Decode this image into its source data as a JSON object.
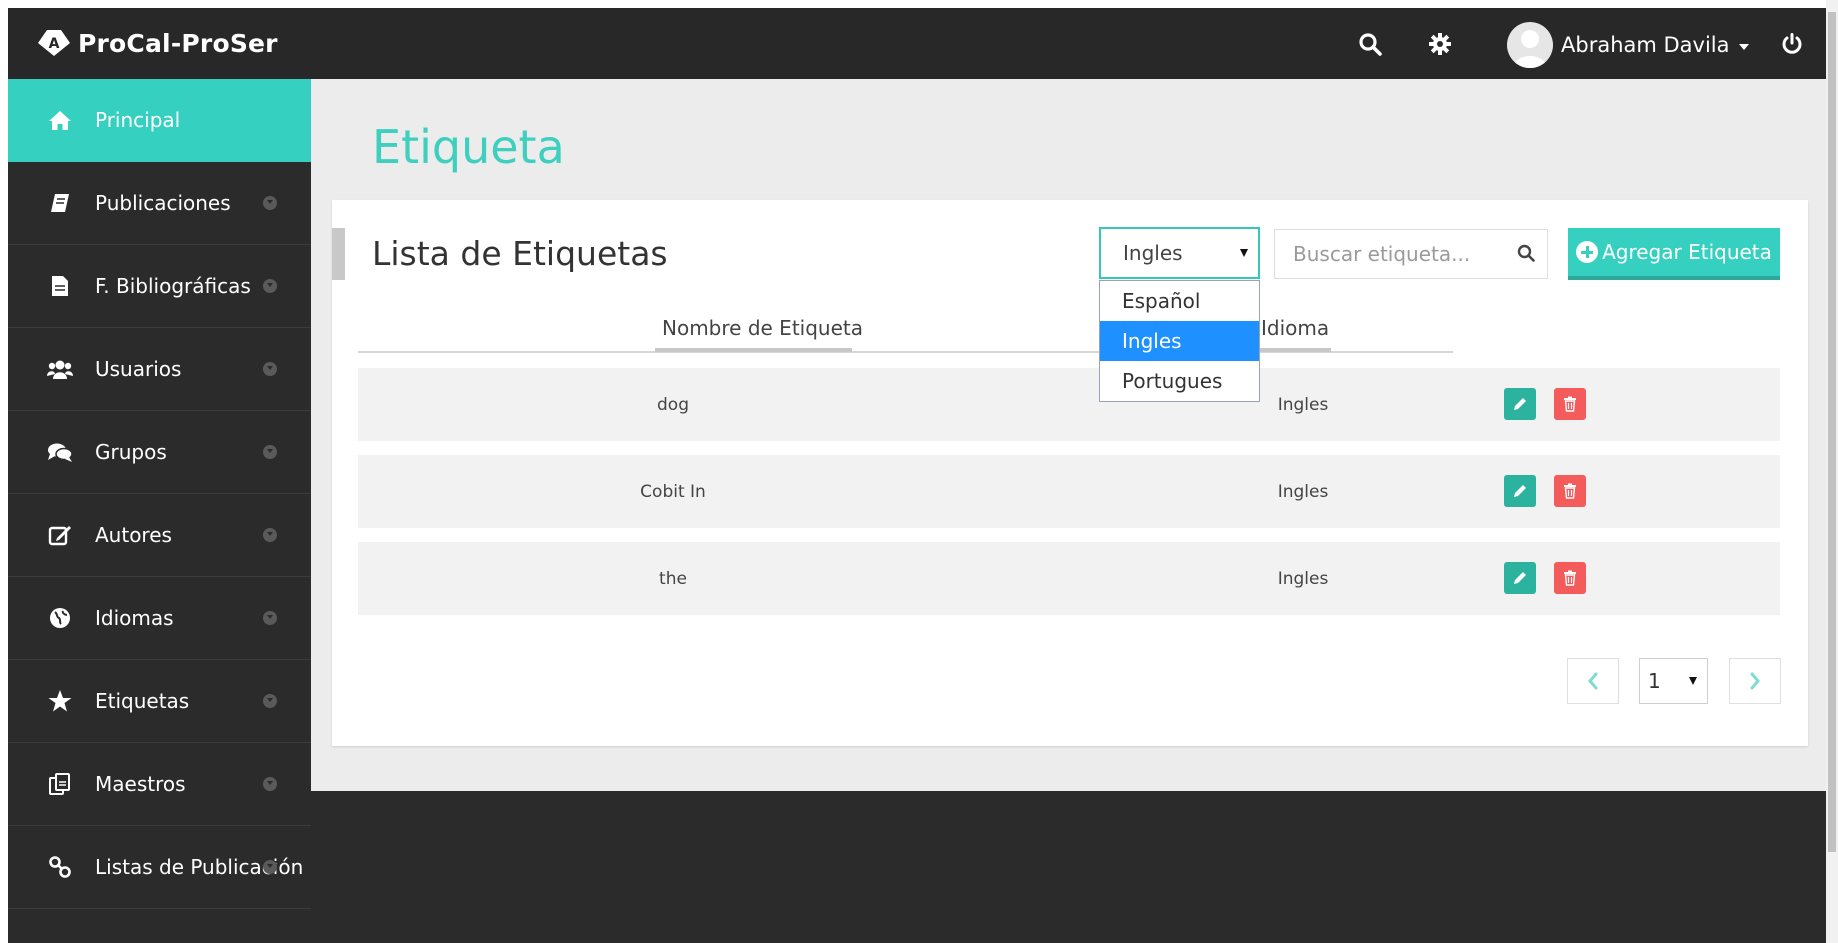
{
  "app": {
    "brand": "ProCal-ProSer"
  },
  "header": {
    "user_name": "Abraham Davila"
  },
  "sidebar": {
    "items": [
      {
        "label": "Principal",
        "icon": "home-icon",
        "active": true
      },
      {
        "label": "Publicaciones",
        "icon": "book-icon"
      },
      {
        "label": "F. Bibliográficas",
        "icon": "file-icon"
      },
      {
        "label": "Usuarios",
        "icon": "users-icon"
      },
      {
        "label": "Grupos",
        "icon": "comments-icon"
      },
      {
        "label": "Autores",
        "icon": "edit-icon"
      },
      {
        "label": "Idiomas",
        "icon": "globe-icon"
      },
      {
        "label": "Etiquetas",
        "icon": "star-icon"
      },
      {
        "label": "Maestros",
        "icon": "copy-icon"
      },
      {
        "label": "Listas de Publicación",
        "icon": "link-icon"
      }
    ]
  },
  "page": {
    "title": "Etiqueta"
  },
  "card": {
    "title": "Lista de Etiquetas"
  },
  "language_filter": {
    "selected": "Ingles",
    "options": [
      "Español",
      "Ingles",
      "Portugues"
    ]
  },
  "search": {
    "placeholder": "Buscar etiqueta...",
    "value": ""
  },
  "add_button": {
    "label": "Agregar Etiqueta"
  },
  "table": {
    "columns": [
      "Nombre de Etiqueta",
      "Idioma"
    ],
    "rows": [
      {
        "name": "dog",
        "language": "Ingles"
      },
      {
        "name": "Cobit In",
        "language": "Ingles"
      },
      {
        "name": "the",
        "language": "Ingles"
      }
    ]
  },
  "pagination": {
    "page": "1"
  },
  "colors": {
    "accent": "#35d0c0",
    "delete": "#f45b5b",
    "edit": "#2bb39f",
    "dark": "#2b2b2b"
  }
}
